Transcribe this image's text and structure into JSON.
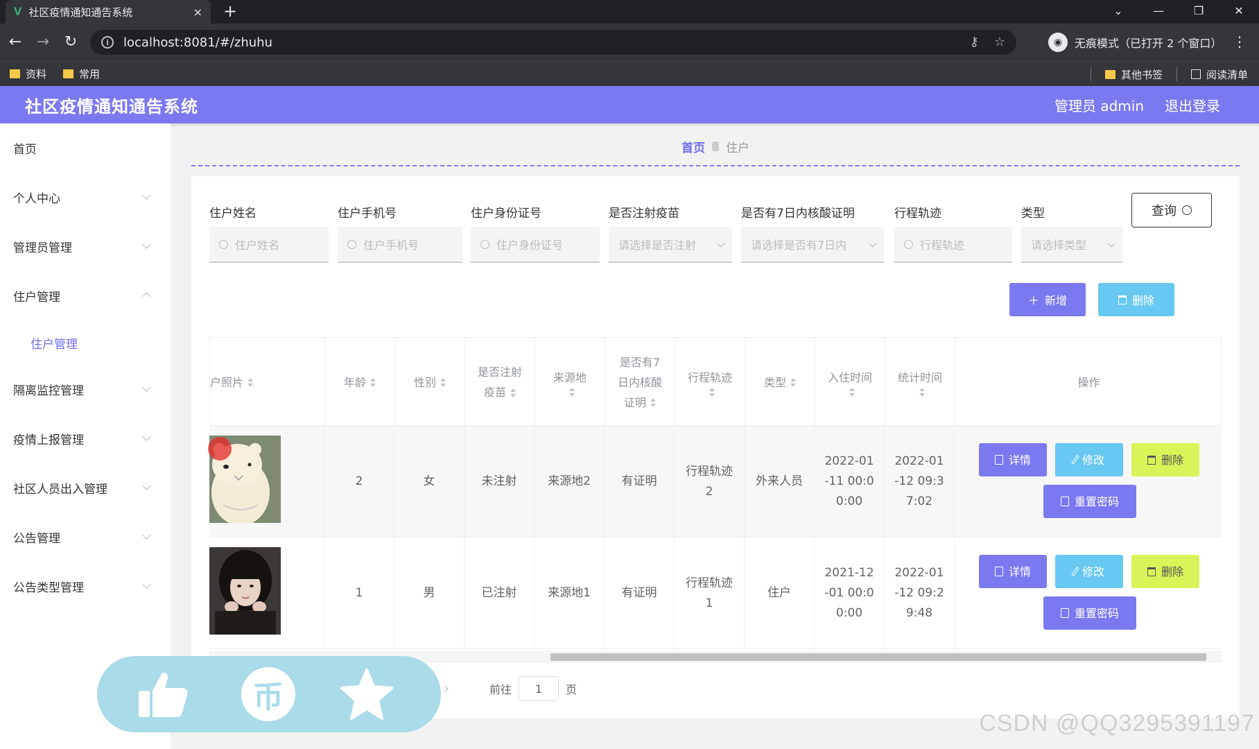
{
  "browser": {
    "tab_title": "社区疫情通知通告系统",
    "tab_close": "×",
    "new_tab": "+",
    "url": "localhost:8081/#/zhuhu",
    "incognito_label": "无痕模式（已打开 2 个窗口）",
    "bookmarks": [
      "资料",
      "常用"
    ],
    "bookmarks_right": [
      "其他书签",
      "阅读清单"
    ]
  },
  "header": {
    "title": "社区疫情通知通告系统",
    "user": "管理员 admin",
    "logout": "退出登录"
  },
  "sidebar": {
    "items": [
      {
        "label": "首页"
      },
      {
        "label": "个人中心"
      },
      {
        "label": "管理员管理"
      },
      {
        "label": "住户管理"
      },
      {
        "label": "住户管理"
      },
      {
        "label": "隔离监控管理"
      },
      {
        "label": "疫情上报管理"
      },
      {
        "label": "社区人员出入管理"
      },
      {
        "label": "公告管理"
      },
      {
        "label": "公告类型管理"
      }
    ]
  },
  "breadcrumb": {
    "home": "首页",
    "current": "住户"
  },
  "filters": {
    "name": {
      "label": "住户姓名",
      "placeholder": "住户姓名"
    },
    "phone": {
      "label": "住户手机号",
      "placeholder": "住户手机号"
    },
    "idcard": {
      "label": "住户身份证号",
      "placeholder": "住户身份证号"
    },
    "vaccine": {
      "label": "是否注射疫苗",
      "placeholder": "请选择是否注射"
    },
    "nucleic": {
      "label": "是否有7日内核酸证明",
      "placeholder": "请选择是否有7日内"
    },
    "trace": {
      "label": "行程轨迹",
      "placeholder": "行程轨迹"
    },
    "type": {
      "label": "类型",
      "placeholder": "请选择类型"
    },
    "query_button": "查询"
  },
  "actions": {
    "add": "新增",
    "delete": "删除"
  },
  "table": {
    "headers": {
      "photo": "户照片",
      "age": "年龄",
      "gender": "性别",
      "vaccine_1": "是否注射",
      "vaccine_2": "疫苗",
      "origin": "来源地",
      "nucleic_1": "是否有7",
      "nucleic_2": "日内核酸",
      "nucleic_3": "证明",
      "trace": "行程轨迹",
      "type": "类型",
      "checkin": "入住时间",
      "stat": "统计时间",
      "ops": "操作"
    },
    "rows": [
      {
        "photo_desc": "bear",
        "age": "2",
        "gender": "女",
        "vaccine": "未注射",
        "origin": "来源地2",
        "nucleic": "有证明",
        "trace_1": "行程轨迹",
        "trace_2": "2",
        "type": "外来人员",
        "checkin_1": "2022-01",
        "checkin_2": "-11 00:0",
        "checkin_3": "0:00",
        "stat_1": "2022-01",
        "stat_2": "-12 09:3",
        "stat_3": "7:02"
      },
      {
        "photo_desc": "girl",
        "age": "1",
        "gender": "男",
        "vaccine": "已注射",
        "origin": "来源地1",
        "nucleic": "有证明",
        "trace_1": "行程轨迹",
        "trace_2": "1",
        "type": "住户",
        "checkin_1": "2021-12",
        "checkin_2": "-01 00:0",
        "checkin_3": "0:00",
        "stat_1": "2022-01",
        "stat_2": "-12 09:2",
        "stat_3": "9:48"
      }
    ],
    "row_ops": {
      "detail": "详情",
      "edit": "修改",
      "remove": "删除",
      "reset": "重置密码"
    }
  },
  "pagination": {
    "goto_prefix": "前往",
    "page_value": "1",
    "goto_suffix": "页"
  },
  "watermark": "CSDN @QQ3295391197",
  "colors": {
    "primary": "#7b79f0",
    "info": "#67c8f1",
    "lime": "#d7f558"
  }
}
